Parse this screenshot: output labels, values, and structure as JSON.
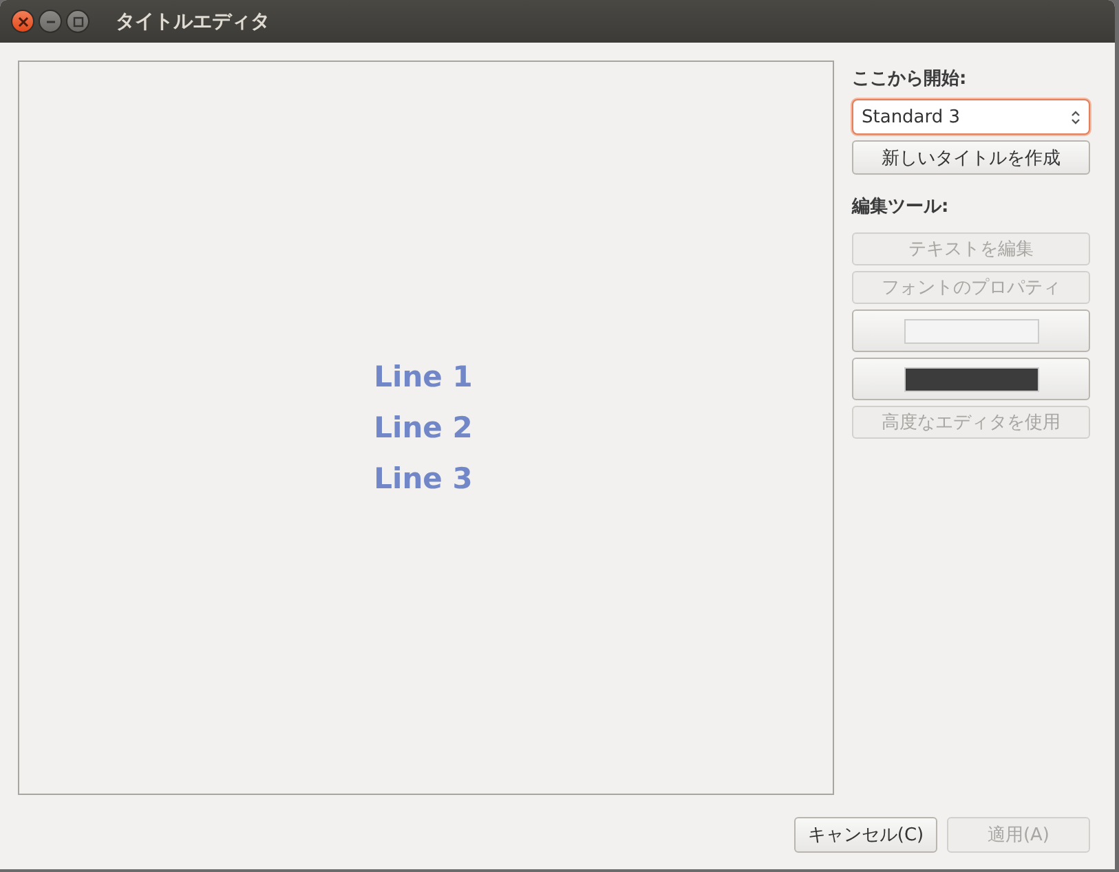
{
  "window": {
    "title": "タイトルエディタ"
  },
  "preview": {
    "lines": [
      "Line 1",
      "Line 2",
      "Line 3"
    ]
  },
  "start_section": {
    "label": "ここから開始:",
    "select": {
      "value": "Standard 3"
    },
    "new_button": {
      "label": "新しいタイトルを作成",
      "disabled": false
    }
  },
  "tools_section": {
    "label": "編集ツール:",
    "buttons": [
      {
        "kind": "text",
        "label": "テキストを編集",
        "disabled": true
      },
      {
        "kind": "text",
        "label": "フォントのプロパティ",
        "disabled": true
      },
      {
        "kind": "swatch",
        "color": "#f4f4f4",
        "disabled": false
      },
      {
        "kind": "swatch",
        "color": "#3c3c3c",
        "disabled": false
      },
      {
        "kind": "text",
        "label": "高度なエディタを使用",
        "disabled": true
      }
    ]
  },
  "footer_buttons": [
    {
      "label": "キャンセル(C)",
      "disabled": false
    },
    {
      "label": "適用(A)",
      "disabled": true
    }
  ]
}
